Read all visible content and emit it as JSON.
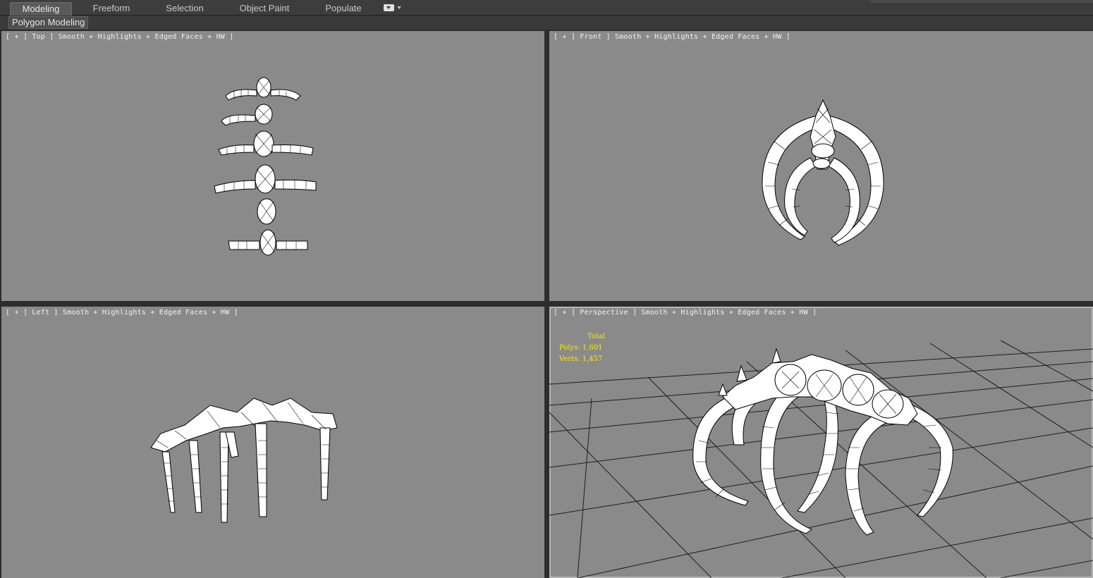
{
  "ribbon": {
    "tabs": [
      {
        "label": "Modeling",
        "active": true
      },
      {
        "label": "Freeform",
        "active": false
      },
      {
        "label": "Selection",
        "active": false
      },
      {
        "label": "Object Paint",
        "active": false
      },
      {
        "label": "Populate",
        "active": false
      }
    ]
  },
  "subribbon": {
    "panel_label": "Polygon Modeling"
  },
  "viewports": {
    "top": {
      "label": "[ + ] Top ] Smooth + Highlights + Edged Faces + HW ]"
    },
    "front": {
      "label": "[ + ] Front ] Smooth + Highlights + Edged Faces + HW ]"
    },
    "left": {
      "label": "[ + ] Left ] Smooth + Highlights + Edged Faces + HW ]"
    },
    "perspective": {
      "label": "[ + ] Perspective ] Smooth + Highlights + Edged Faces + HW ]",
      "stats": {
        "total": "Total",
        "polys": "Polys: 1,601",
        "verts": "Verts: 1,457"
      }
    }
  },
  "colors": {
    "viewport_bg": "#8a8a8a",
    "stats_text": "#ffe800",
    "wire": "#000000",
    "mesh": "#ffffff"
  }
}
